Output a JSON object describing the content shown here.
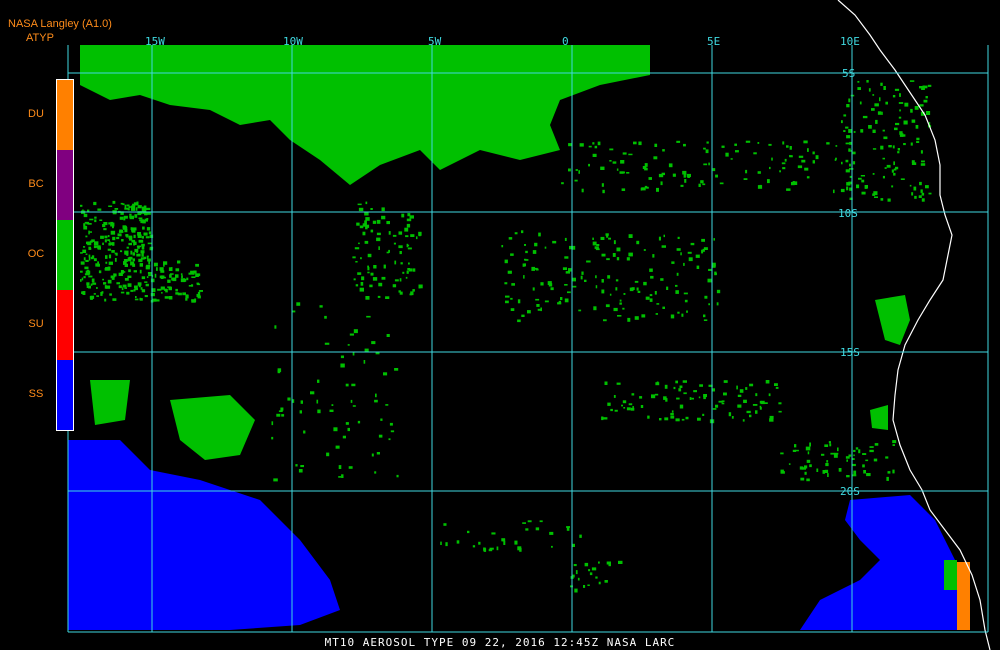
{
  "header": {
    "source": "NASA Langley (A1.0)",
    "product": "ATYP"
  },
  "legend": [
    {
      "label": "DU",
      "color": "#ff8000"
    },
    {
      "label": "BC",
      "color": "#800080"
    },
    {
      "label": "OC",
      "color": "#00c000"
    },
    {
      "label": "SU",
      "color": "#ff0000"
    },
    {
      "label": "SS",
      "color": "#0000ff"
    }
  ],
  "grid": {
    "longitudes": [
      "15W",
      "10W",
      "5W",
      "0",
      "5E",
      "10E"
    ],
    "latitudes": [
      "5S",
      "10S",
      "15S",
      "20S"
    ],
    "color": "#3fd9e0"
  },
  "footer": "MT10  AEROSOL TYPE   09 22, 2016 12:45Z   NASA LARC",
  "colors": {
    "background": "#000000",
    "coastline": "#ffffff",
    "oc": "#00c000",
    "ss": "#0000ff",
    "du": "#ff8000"
  }
}
